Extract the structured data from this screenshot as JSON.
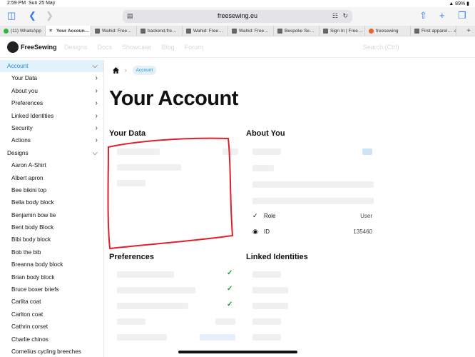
{
  "status": {
    "time": "2:59 PM",
    "date": "Sun 25 May",
    "right": "▲ 89% ▮"
  },
  "browser": {
    "url": "freesewing.eu",
    "tabs": [
      {
        "title": "(11) WhatsApp",
        "active": false,
        "fav": "g"
      },
      {
        "title": "Your Accoun…",
        "active": true,
        "fav": "x"
      },
      {
        "title": "Wahid: Free…",
        "active": false,
        "fav": "d"
      },
      {
        "title": "backend.fre…",
        "active": false,
        "fav": "d"
      },
      {
        "title": "Wahid: Free…",
        "active": false,
        "fav": "d"
      },
      {
        "title": "Wahid: Free…",
        "active": false,
        "fav": "d"
      },
      {
        "title": "Bespoke Se…",
        "active": false,
        "fav": "d"
      },
      {
        "title": "Sign In | Free…",
        "active": false,
        "fav": "d"
      },
      {
        "title": "freesewing",
        "active": false,
        "fav": "o"
      },
      {
        "title": "First apparel… .com",
        "active": false,
        "fav": "d"
      }
    ]
  },
  "app": {
    "brand": "FreeSewing",
    "nav_blurred": [
      "Designs",
      "Docs",
      "Showcase",
      "Blog",
      "Forum",
      "Search (Ctrl)"
    ]
  },
  "sidebar": {
    "items": [
      {
        "label": "Account",
        "level": "top",
        "active": true,
        "chev": "⌵"
      },
      {
        "label": "Your Data",
        "level": "sub",
        "active": false,
        "chev": "›"
      },
      {
        "label": "About you",
        "level": "sub",
        "active": false,
        "chev": "›"
      },
      {
        "label": "Preferences",
        "level": "sub",
        "active": false,
        "chev": "›"
      },
      {
        "label": "Linked Identities",
        "level": "sub",
        "active": false,
        "chev": "›"
      },
      {
        "label": "Security",
        "level": "sub",
        "active": false,
        "chev": "›"
      },
      {
        "label": "Actions",
        "level": "sub",
        "active": false,
        "chev": "›"
      },
      {
        "label": "Designs",
        "level": "top",
        "active": false,
        "chev": "⌵"
      },
      {
        "label": "Aaron A-Shirt",
        "level": "sub",
        "active": false,
        "chev": ""
      },
      {
        "label": "Albert apron",
        "level": "sub",
        "active": false,
        "chev": ""
      },
      {
        "label": "Bee bikini top",
        "level": "sub",
        "active": false,
        "chev": ""
      },
      {
        "label": "Bella body block",
        "level": "sub",
        "active": false,
        "chev": ""
      },
      {
        "label": "Benjamin bow tie",
        "level": "sub",
        "active": false,
        "chev": ""
      },
      {
        "label": "Bent body Block",
        "level": "sub",
        "active": false,
        "chev": ""
      },
      {
        "label": "Bibi body block",
        "level": "sub",
        "active": false,
        "chev": ""
      },
      {
        "label": "Bob the bib",
        "level": "sub",
        "active": false,
        "chev": ""
      },
      {
        "label": "Breanna body block",
        "level": "sub",
        "active": false,
        "chev": ""
      },
      {
        "label": "Brian body block",
        "level": "sub",
        "active": false,
        "chev": ""
      },
      {
        "label": "Bruce boxer briefs",
        "level": "sub",
        "active": false,
        "chev": ""
      },
      {
        "label": "Carlita coat",
        "level": "sub",
        "active": false,
        "chev": ""
      },
      {
        "label": "Carlton coat",
        "level": "sub",
        "active": false,
        "chev": ""
      },
      {
        "label": "Cathrin corset",
        "level": "sub",
        "active": false,
        "chev": ""
      },
      {
        "label": "Charlie chinos",
        "level": "sub",
        "active": false,
        "chev": ""
      },
      {
        "label": "Cornelius cycling breeches",
        "level": "sub",
        "active": false,
        "chev": ""
      }
    ]
  },
  "main": {
    "breadcrumb": "Account",
    "title": "Your Account",
    "your_data_title": "Your Data",
    "about_title": "About You",
    "preferences_title": "Preferences",
    "linked_title": "Linked Identities",
    "about_role_label": "Role",
    "about_role_value": "User",
    "about_id_label": "ID",
    "about_id_value": "135460"
  },
  "colors": {
    "accent": "#1a8fd4",
    "active_bg": "#e3f1fb",
    "check": "#1a9e3a",
    "annotation": "#e0202a"
  }
}
